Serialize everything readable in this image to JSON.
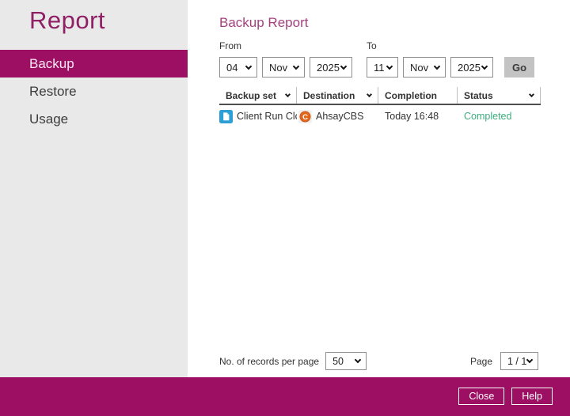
{
  "sidebar": {
    "title": "Report",
    "items": [
      {
        "label": "Backup",
        "selected": true
      },
      {
        "label": "Restore",
        "selected": false
      },
      {
        "label": "Usage",
        "selected": false
      }
    ]
  },
  "main": {
    "heading": "Backup Report",
    "filter": {
      "from_label": "From",
      "to_label": "To",
      "from": {
        "day": "04",
        "month": "Nov",
        "year": "2025"
      },
      "to": {
        "day": "11",
        "month": "Nov",
        "year": "2025"
      },
      "go_label": "Go"
    },
    "table": {
      "columns": [
        {
          "label": "Backup set",
          "has_menu": true
        },
        {
          "label": "Destination",
          "has_menu": true
        },
        {
          "label": "Completion",
          "has_menu": false
        },
        {
          "label": "Status",
          "has_menu": true
        }
      ],
      "rows": [
        {
          "backup_set": "Client Run Clo...",
          "backup_set_icon": "file-document-icon",
          "destination": "AhsayCBS",
          "destination_icon": "ahsaycbs-icon",
          "completion": "Today 16:48",
          "status": "Completed"
        }
      ]
    },
    "pagination": {
      "records_label": "No. of records per page",
      "records_value": "50",
      "page_label": "Page",
      "page_value": "1 / 1"
    }
  },
  "footer": {
    "close_label": "Close",
    "help_label": "Help"
  },
  "colors": {
    "brand_magenta": "#9d0f63",
    "sidebar_bg": "#e9e9e9",
    "heading_text": "#a3407e",
    "status_completed_green": "#3dae7d",
    "file_icon_blue": "#2d9fd6",
    "ahsay_icon_orange": "#e2661c",
    "go_button_gray": "#c3c3c3"
  }
}
